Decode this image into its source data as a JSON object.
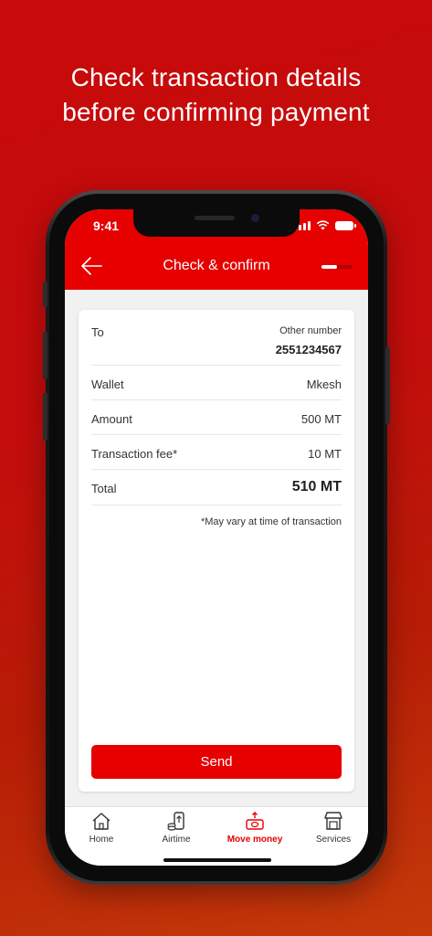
{
  "headline": {
    "line1": "Check transaction details",
    "line2": "before confirming payment"
  },
  "status_bar": {
    "time": "9:41"
  },
  "header": {
    "title": "Check & confirm",
    "progress_fraction": 0.5
  },
  "details": {
    "to": {
      "label": "To",
      "type": "Other number",
      "number": "2551234567"
    },
    "wallet": {
      "label": "Wallet",
      "value": "Mkesh"
    },
    "amount": {
      "label": "Amount",
      "value": "500 MT"
    },
    "fee": {
      "label": "Transaction fee*",
      "value": "10 MT"
    },
    "total": {
      "label": "Total",
      "value": "510 MT"
    },
    "note": "*May vary at time of transaction"
  },
  "send_label": "Send",
  "tabs": [
    {
      "label": "Home",
      "icon": "home-icon"
    },
    {
      "label": "Airtime",
      "icon": "phone-topup-icon"
    },
    {
      "label": "Move money",
      "icon": "money-transfer-icon",
      "active": true
    },
    {
      "label": "Services",
      "icon": "store-icon"
    }
  ],
  "colors": {
    "brand": "#e60000",
    "background": "#c40c0c"
  }
}
